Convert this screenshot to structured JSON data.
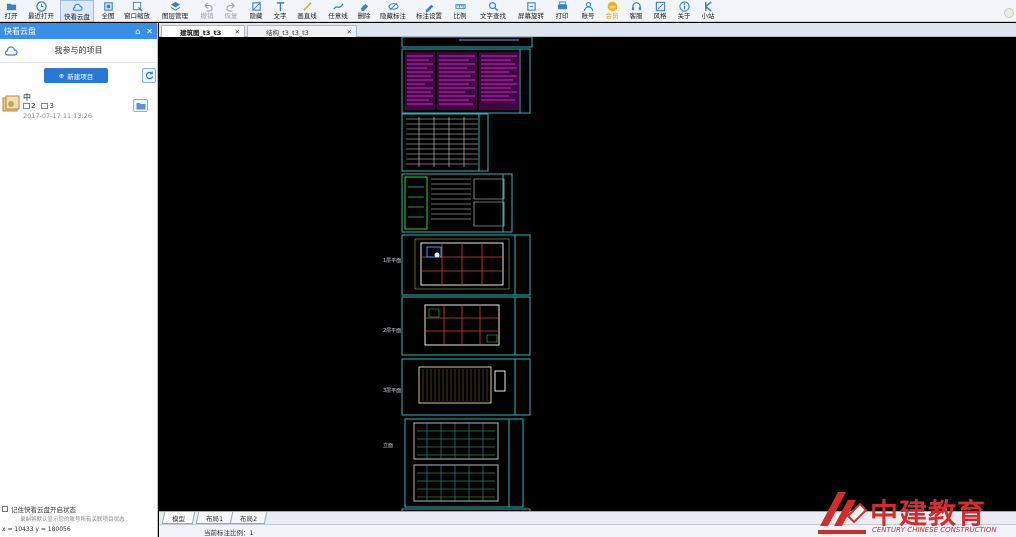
{
  "toolbar": {
    "items": [
      {
        "label": "打开",
        "icon": "folder-open-icon"
      },
      {
        "label": "最近打开",
        "icon": "clock-icon"
      },
      {
        "label": "快看云盘",
        "icon": "cloud-icon"
      },
      {
        "label": "全图",
        "icon": "fit-view-icon"
      },
      {
        "label": "窗口缩放",
        "icon": "zoom-window-icon"
      },
      {
        "label": "图层管理",
        "icon": "layers-icon"
      },
      {
        "label": "撤销",
        "icon": "undo-icon"
      },
      {
        "label": "恢复",
        "icon": "redo-icon"
      },
      {
        "label": "隐藏",
        "icon": "hide-icon"
      },
      {
        "label": "文字",
        "icon": "text-icon"
      },
      {
        "label": "画直线",
        "icon": "line-icon"
      },
      {
        "label": "任意线",
        "icon": "freehand-icon"
      },
      {
        "label": "删除",
        "icon": "eraser-icon"
      },
      {
        "label": "隐藏标注",
        "icon": "hide-annotation-icon"
      },
      {
        "label": "标注设置",
        "icon": "annotation-settings-icon"
      },
      {
        "label": "比例",
        "icon": "scale-icon"
      },
      {
        "label": "文字查找",
        "icon": "text-search-icon"
      },
      {
        "label": "屏幕旋转",
        "icon": "rotate-screen-icon"
      },
      {
        "label": "打印",
        "icon": "print-icon"
      },
      {
        "label": "账号",
        "icon": "account-icon"
      },
      {
        "label": "会员",
        "icon": "vip-icon"
      },
      {
        "label": "客服",
        "icon": "headset-icon"
      },
      {
        "label": "风格",
        "icon": "style-icon"
      },
      {
        "label": "关于",
        "icon": "info-icon"
      },
      {
        "label": "小站",
        "icon": "k-station-icon"
      }
    ],
    "vip_badge": "VIP"
  },
  "panel": {
    "title": "快看云盘",
    "pin_glyph": "⌂",
    "close_glyph": "✕",
    "section_title": "我参与的项目",
    "new_project_label": "新建项目",
    "project": {
      "name": "中",
      "drawings": "2",
      "members": "3",
      "date": "2017-07-17 11:13:26"
    },
    "remember_label": "记住快看云盘开启状态",
    "hint": "录制将默认显示您的账号所有关联项目状态",
    "coords": "x = 10433  y = 180056"
  },
  "doc_tabs": [
    {
      "label": "建筑图_t3_t3",
      "close": "✕"
    },
    {
      "label": "结构_t3_t3_t3",
      "close": "✕"
    }
  ],
  "canvas": {
    "sheet_labels": [
      "1层平面",
      "2层平面",
      "3层平面",
      "立面"
    ],
    "colors": {
      "frame": "#27b6b6",
      "background": "#000000",
      "magenta": "#d61fd6"
    }
  },
  "layout_tabs": [
    "模型",
    "布局1",
    "布局2"
  ],
  "status": {
    "text": "当前标注比例：1"
  },
  "brand": {
    "name": "中建教育",
    "sub": "CENTURY CHINESE CONSTRUCTION",
    "color": "#d62b2b"
  }
}
